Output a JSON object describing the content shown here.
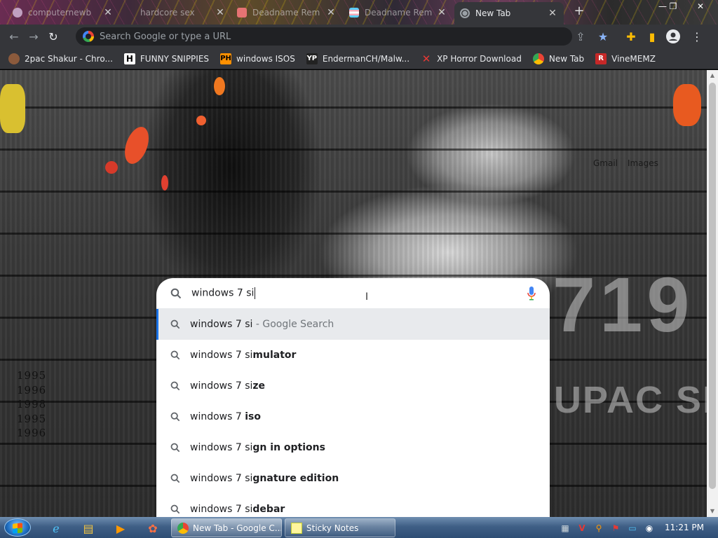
{
  "tabs": [
    {
      "title": "computernewb",
      "active": false
    },
    {
      "title": "hardcore sex",
      "active": false
    },
    {
      "title": "Deadname Rem",
      "active": false
    },
    {
      "title": "Deadname Rem",
      "active": false
    },
    {
      "title": "New Tab",
      "active": true
    }
  ],
  "omnibox": {
    "placeholder": "Search Google or type a URL"
  },
  "bookmarks": [
    {
      "label": "2pac Shakur - Chro...",
      "icon": "2pac-icon"
    },
    {
      "label": "FUNNY SNIPPIES",
      "icon": "h-icon"
    },
    {
      "label": "windows ISOS",
      "icon": "ph-icon"
    },
    {
      "label": "EndermanCH/Malw...",
      "icon": "yp-icon"
    },
    {
      "label": "XP Horror Download",
      "icon": "x-icon"
    },
    {
      "label": "New Tab",
      "icon": "chrome-icon"
    },
    {
      "label": "VineMEMZ",
      "icon": "r-icon"
    }
  ],
  "header_links": {
    "gmail": "Gmail",
    "images": "Images"
  },
  "wallpaper": {
    "years": [
      "1995",
      "1996",
      "1998",
      "1995",
      "1996"
    ],
    "big_number": "719",
    "big_name": "UPAC SH"
  },
  "search": {
    "query": "windows 7 si",
    "suggestions": [
      {
        "prefix": "windows 7 si",
        "bold": "",
        "tail": " - Google Search",
        "selected": true
      },
      {
        "prefix": "windows 7 si",
        "bold": "mulator",
        "tail": "",
        "selected": false
      },
      {
        "prefix": "windows 7 si",
        "bold": "ze",
        "tail": "",
        "selected": false
      },
      {
        "prefix": "windows 7 ",
        "bold": "iso",
        "tail": "",
        "selected": false
      },
      {
        "prefix": "windows 7 si",
        "bold": "gn in options",
        "tail": "",
        "selected": false
      },
      {
        "prefix": "windows 7 si",
        "bold": "gnature edition",
        "tail": "",
        "selected": false
      },
      {
        "prefix": "windows 7 si",
        "bold": "debar",
        "tail": "",
        "selected": false
      }
    ]
  },
  "taskbar": {
    "tasks": [
      {
        "label": "New Tab - Google C...",
        "active": true
      },
      {
        "label": "Sticky Notes",
        "active": false
      }
    ],
    "clock": "11:21 PM"
  },
  "colors": {
    "accent": "#1a73e8",
    "chrome_dark": "#35363a",
    "omnibox": "#202124"
  }
}
